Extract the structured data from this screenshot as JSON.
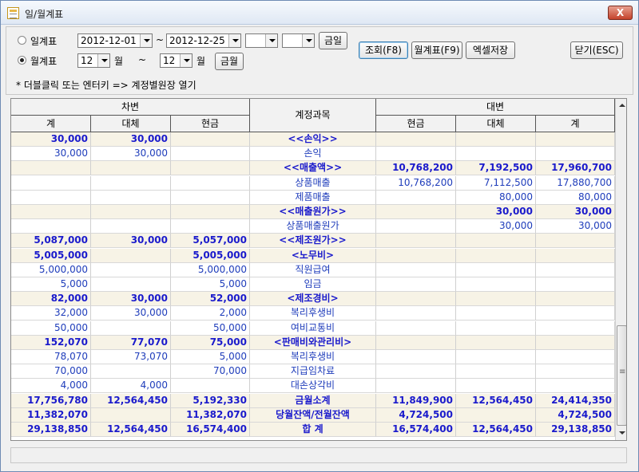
{
  "window": {
    "title": "일/월계표",
    "close_label": "X"
  },
  "toolbar": {
    "daily_label": "일계표",
    "monthly_label": "월계표",
    "date_from": "2012-12-01",
    "date_tilde": "~",
    "date_to": "2012-12-25",
    "date_extra1": "",
    "date_extra2": "",
    "today_button": "금일",
    "month_from": "12",
    "month_to": "12",
    "month_unit": "월",
    "month_tilde": "~",
    "this_month_button": "금월",
    "query_button": "조회(F8)",
    "monthly_report_button": "월계표(F9)",
    "excel_button": "엑셀저장",
    "close_button": "닫기(ESC)",
    "hint": "* 더블클릭 또는 엔터키 => 계정별원장 열기"
  },
  "grid": {
    "group_debit": "차변",
    "group_account": "계정과목",
    "group_credit": "대변",
    "cols": [
      "계",
      "대체",
      "현금",
      "현금",
      "대체",
      "계"
    ],
    "rows": [
      {
        "bold": true,
        "d_total": "30,000",
        "d_transfer": "30,000",
        "d_cash": "",
        "account": "<<손익>>",
        "c_cash": "",
        "c_transfer": "",
        "c_total": ""
      },
      {
        "bold": false,
        "d_total": "30,000",
        "d_transfer": "30,000",
        "d_cash": "",
        "account": "손익",
        "c_cash": "",
        "c_transfer": "",
        "c_total": ""
      },
      {
        "bold": true,
        "d_total": "",
        "d_transfer": "",
        "d_cash": "",
        "account": "<<매출액>>",
        "c_cash": "10,768,200",
        "c_transfer": "7,192,500",
        "c_total": "17,960,700"
      },
      {
        "bold": false,
        "d_total": "",
        "d_transfer": "",
        "d_cash": "",
        "account": "상품매출",
        "c_cash": "10,768,200",
        "c_transfer": "7,112,500",
        "c_total": "17,880,700"
      },
      {
        "bold": false,
        "d_total": "",
        "d_transfer": "",
        "d_cash": "",
        "account": "제품매출",
        "c_cash": "",
        "c_transfer": "80,000",
        "c_total": "80,000"
      },
      {
        "bold": true,
        "d_total": "",
        "d_transfer": "",
        "d_cash": "",
        "account": "<<매출원가>>",
        "c_cash": "",
        "c_transfer": "30,000",
        "c_total": "30,000"
      },
      {
        "bold": false,
        "d_total": "",
        "d_transfer": "",
        "d_cash": "",
        "account": "상품매출원가",
        "c_cash": "",
        "c_transfer": "30,000",
        "c_total": "30,000"
      },
      {
        "bold": true,
        "d_total": "5,087,000",
        "d_transfer": "30,000",
        "d_cash": "5,057,000",
        "account": "<<제조원가>>",
        "c_cash": "",
        "c_transfer": "",
        "c_total": ""
      },
      {
        "bold": true,
        "d_total": "5,005,000",
        "d_transfer": "",
        "d_cash": "5,005,000",
        "account": "<노무비>",
        "c_cash": "",
        "c_transfer": "",
        "c_total": ""
      },
      {
        "bold": false,
        "d_total": "5,000,000",
        "d_transfer": "",
        "d_cash": "5,000,000",
        "account": "직원급여",
        "c_cash": "",
        "c_transfer": "",
        "c_total": ""
      },
      {
        "bold": false,
        "d_total": "5,000",
        "d_transfer": "",
        "d_cash": "5,000",
        "account": "임금",
        "c_cash": "",
        "c_transfer": "",
        "c_total": ""
      },
      {
        "bold": true,
        "d_total": "82,000",
        "d_transfer": "30,000",
        "d_cash": "52,000",
        "account": "<제조경비>",
        "c_cash": "",
        "c_transfer": "",
        "c_total": ""
      },
      {
        "bold": false,
        "d_total": "32,000",
        "d_transfer": "30,000",
        "d_cash": "2,000",
        "account": "복리후생비",
        "c_cash": "",
        "c_transfer": "",
        "c_total": ""
      },
      {
        "bold": false,
        "d_total": "50,000",
        "d_transfer": "",
        "d_cash": "50,000",
        "account": "여비교통비",
        "c_cash": "",
        "c_transfer": "",
        "c_total": ""
      },
      {
        "bold": true,
        "d_total": "152,070",
        "d_transfer": "77,070",
        "d_cash": "75,000",
        "account": "<판매비와관리비>",
        "c_cash": "",
        "c_transfer": "",
        "c_total": ""
      },
      {
        "bold": false,
        "d_total": "78,070",
        "d_transfer": "73,070",
        "d_cash": "5,000",
        "account": "복리후생비",
        "c_cash": "",
        "c_transfer": "",
        "c_total": ""
      },
      {
        "bold": false,
        "d_total": "70,000",
        "d_transfer": "",
        "d_cash": "70,000",
        "account": "지급임차료",
        "c_cash": "",
        "c_transfer": "",
        "c_total": ""
      },
      {
        "bold": false,
        "d_total": "4,000",
        "d_transfer": "4,000",
        "d_cash": "",
        "account": "대손상각비",
        "c_cash": "",
        "c_transfer": "",
        "c_total": ""
      },
      {
        "bold": true,
        "d_total": "17,756,780",
        "d_transfer": "12,564,450",
        "d_cash": "5,192,330",
        "account": "금월소계",
        "c_cash": "11,849,900",
        "c_transfer": "12,564,450",
        "c_total": "24,414,350"
      },
      {
        "bold": true,
        "d_total": "11,382,070",
        "d_transfer": "",
        "d_cash": "11,382,070",
        "account": "당월잔액/전월잔액",
        "c_cash": "4,724,500",
        "c_transfer": "",
        "c_total": "4,724,500"
      },
      {
        "bold": true,
        "d_total": "29,138,850",
        "d_transfer": "12,564,450",
        "d_cash": "16,574,400",
        "account": "합          계",
        "c_cash": "16,574,400",
        "c_transfer": "12,564,450",
        "c_total": "29,138,850"
      }
    ]
  }
}
